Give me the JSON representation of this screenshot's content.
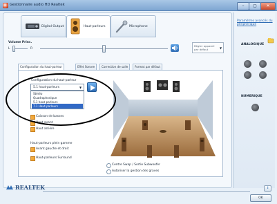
{
  "window": {
    "title": "Gestionnaire audio HD Realtek",
    "min_label": "–",
    "max_label": "▢",
    "close_label": "✕"
  },
  "device_tabs": [
    {
      "label": "Digital Output"
    },
    {
      "label": "Haut-parleurs"
    },
    {
      "label": "Microphone"
    }
  ],
  "volume": {
    "label": "Volume Princ.",
    "left_mark": "L",
    "right_mark": "R",
    "balance": 0.1,
    "level": 0.5,
    "set_default_label": "Régler appareil par défaut"
  },
  "subtabs": [
    {
      "label": "Configuration du haut-parleur"
    },
    {
      "label": "Effet Sonore"
    },
    {
      "label": "Correction de salle"
    },
    {
      "label": "Format par défaut"
    }
  ],
  "config": {
    "label": "Configuration du haut-parleur",
    "selected": "5.1 haut-parleurs",
    "options": [
      "Stéréo",
      "Quadraphonique",
      "5.1 haut-parleurs",
      "7.1 Haut-parleurs"
    ],
    "highlighted_index": 3
  },
  "options_left": {
    "items": [
      {
        "label": "Caisson de basses",
        "checked": true
      },
      {
        "label": "Haut avant",
        "checked": true
      },
      {
        "label": "Haut arrière",
        "checked": true
      }
    ],
    "fullrange_label": "Haut-parleurs plein gamme",
    "fullrange_items": [
      {
        "label": "Avant gauche et droit",
        "checked": true
      },
      {
        "label": "Haut-parleurs Surround",
        "checked": true
      }
    ]
  },
  "options_bottom": [
    {
      "label": "Centre Swap / Sortie Subwoofer",
      "checked": false
    },
    {
      "label": "Autoriser la gestion des graves",
      "checked": false
    }
  ],
  "right_panel": {
    "link": "Paramètres avancés du périphérique",
    "analog_label": "ANALOGIQUE",
    "digital_label": "NUMERIQUE"
  },
  "footer": {
    "brand": "REALTEK",
    "info_icon": "i",
    "ok_label": "OK"
  },
  "colors": {
    "accent": "#2f6db5",
    "highlight": "#3169c6",
    "checkbox": "#f2a93b"
  }
}
